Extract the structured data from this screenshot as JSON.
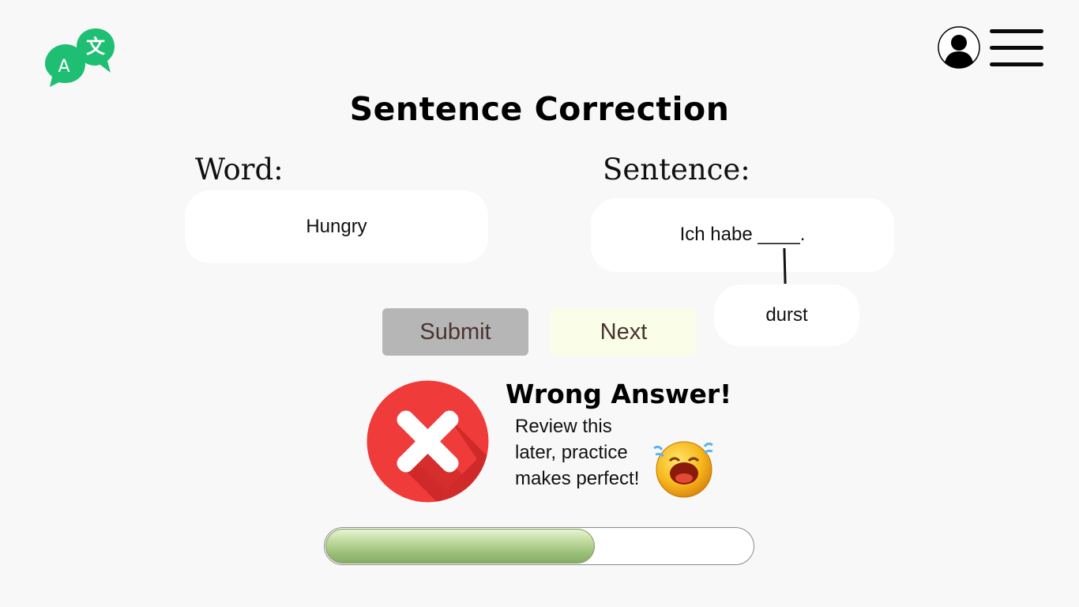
{
  "page": {
    "title": "Sentence Correction"
  },
  "header": {
    "logo_icon": "translate-chat-bubbles-icon",
    "logo_letters": [
      "A",
      "文"
    ],
    "profile_icon": "user-avatar-icon",
    "menu_icon": "hamburger-menu-icon"
  },
  "word": {
    "label": "Word:",
    "value": "Hungry"
  },
  "sentence": {
    "label": "Sentence:",
    "value": "Ich habe ____.",
    "answer": "durst"
  },
  "buttons": {
    "submit_label": "Submit",
    "next_label": "Next"
  },
  "feedback": {
    "icon": "red-x-circle-icon",
    "title": "Wrong Answer!",
    "message": "Review this later, practice makes perfect!",
    "emoji": "crying-face-emoji-icon"
  },
  "progress": {
    "value_percent": 63
  },
  "colors": {
    "background": "#f8f8f8",
    "brand_green": "#1fbf73",
    "submit_bg": "#b6b6b6",
    "next_bg": "#fafde8",
    "button_text": "#4a3430",
    "error_red": "#ee3a3a",
    "progress_green": "#9cc07a"
  }
}
